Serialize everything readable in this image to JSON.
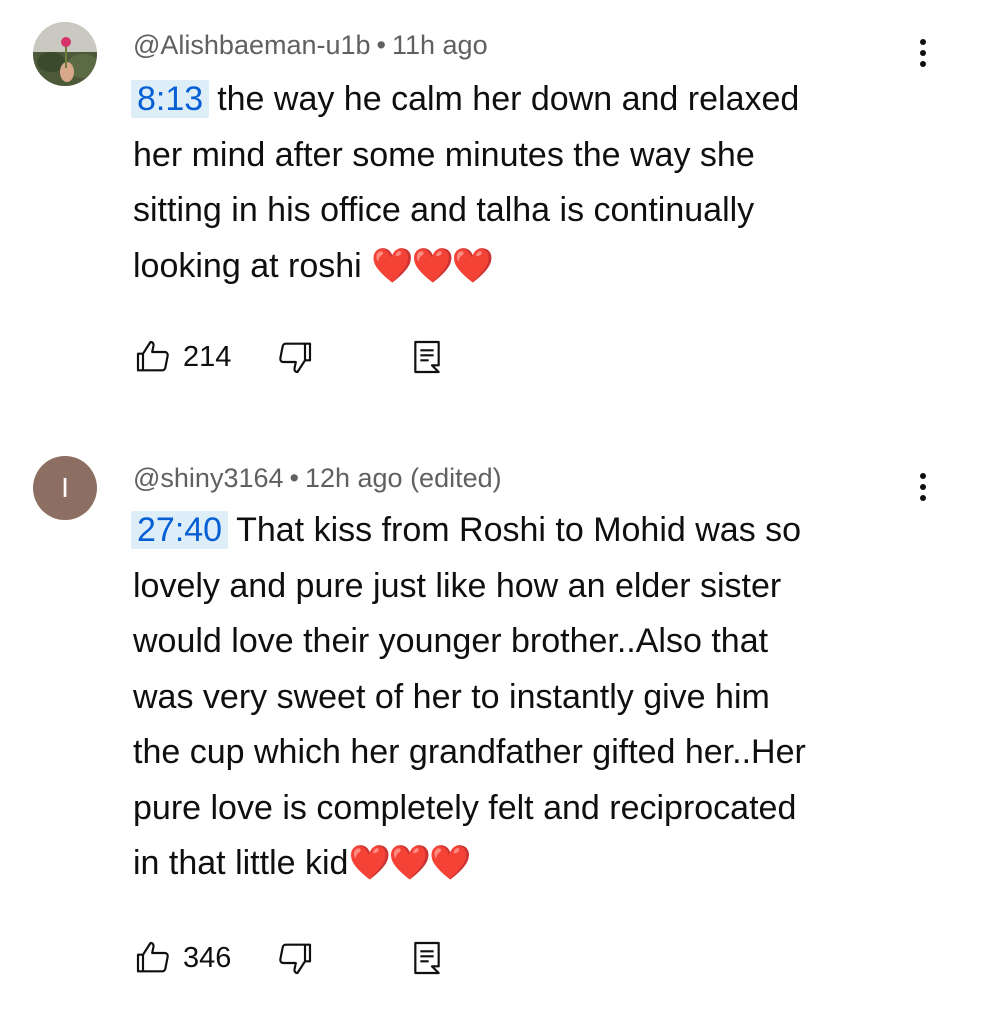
{
  "comments": [
    {
      "author": "@Alishbaeman-u1b",
      "separator": "•",
      "time": "11h ago",
      "timestamp_link": "8:13",
      "lines": [
        "the way he calm her down and relaxed",
        "her mind after some minutes the way she",
        "sitting in his office and talha is continually",
        "looking at roshi "
      ],
      "hearts": "❤️❤️❤️",
      "likes": "214",
      "avatar_type": "photo"
    },
    {
      "author": "@shiny3164",
      "separator": "•",
      "time": "12h ago (edited)",
      "avatar_letter": "I",
      "avatar_color": "#8d6e63",
      "timestamp_link": "27:40",
      "lines": [
        "That kiss from Roshi to Mohid was so",
        "lovely and pure just like how an elder sister",
        "would love their younger brother..Also that",
        "was very sweet of her to instantly give him",
        "the cup which her grandfather gifted her..Her",
        "pure love is completely felt and reciprocated",
        "in that little kid"
      ],
      "hearts": "❤️❤️❤️",
      "likes": "346"
    }
  ],
  "icons": {
    "like": "thumb-up-icon",
    "dislike": "thumb-down-icon",
    "reply": "reply-comment-icon",
    "menu": "more-vert-icon"
  },
  "colors": {
    "timestamp_link": "#065fd4",
    "timestamp_bg": "#ddeef9",
    "secondary_text": "#606060",
    "heart": "#e0223a"
  }
}
